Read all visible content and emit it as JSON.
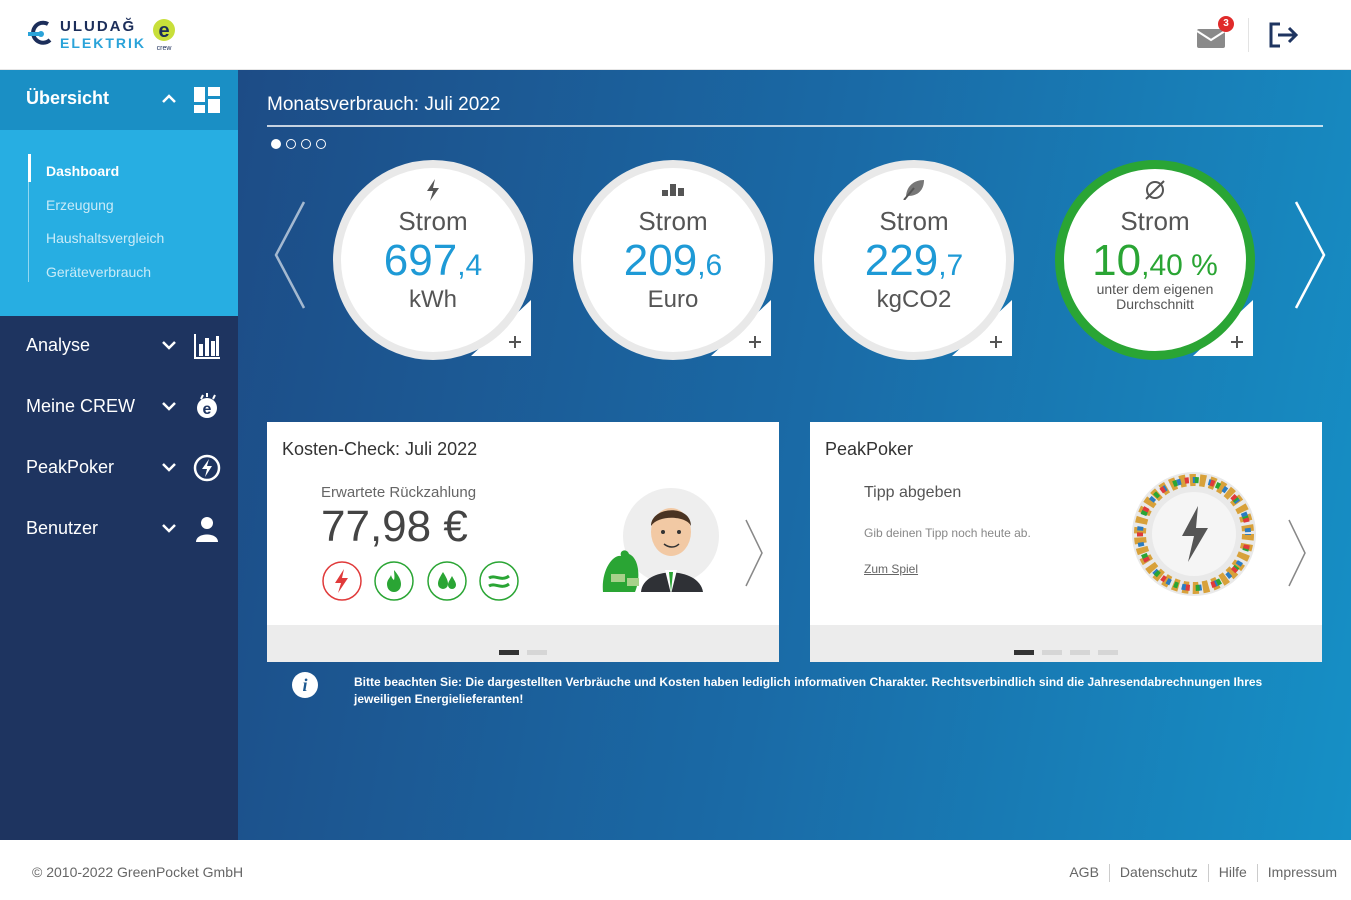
{
  "header": {
    "logo_line1": "ULUDAĞ",
    "logo_line2": "ELEKTRIK",
    "logo_crew": "crew",
    "mail_badge": "3"
  },
  "sidebar": {
    "open_section": "Übersicht",
    "sub_items": [
      "Dashboard",
      "Erzeugung",
      "Haushaltsvergleich",
      "Geräteverbrauch"
    ],
    "sections": [
      "Analyse",
      "Meine CREW",
      "PeakPoker",
      "Benutzer"
    ]
  },
  "main": {
    "month_title": "Monatsverbrauch: Juli 2022",
    "gauges": [
      {
        "label": "Strom",
        "value_int": "697",
        "value_dec": ",4",
        "unit": "kWh",
        "icon": "lightning-icon"
      },
      {
        "label": "Strom",
        "value_int": "209",
        "value_dec": ",6",
        "unit": "Euro",
        "icon": "coins-icon"
      },
      {
        "label": "Strom",
        "value_int": "229",
        "value_dec": ",7",
        "unit": "kgCO2",
        "icon": "leaf-icon"
      },
      {
        "label": "Strom",
        "value_int": "10",
        "value_dec": ",40 %",
        "unit": "unter dem eigenen Durchschnitt",
        "icon": "average-icon"
      }
    ],
    "cost_card": {
      "title": "Kosten-Check: Juli 2022",
      "subtitle": "Erwartete Rückzahlung",
      "value": "77,98 €"
    },
    "peak_card": {
      "title": "PeakPoker",
      "subtitle": "Tipp abgeben",
      "hint": "Gib deinen Tipp noch heute ab.",
      "link": "Zum Spiel"
    },
    "info_icon": "i",
    "notice": "Bitte beachten Sie: Die dargestellten Verbräuche und Kosten haben lediglich informativen Charakter. Rechtsverbindlich sind die Jahresendabrechnungen Ihres jeweiligen Energielieferanten!"
  },
  "footer": {
    "copyright": "© 2010-2022 GreenPocket GmbH",
    "links": [
      "AGB",
      "Datenschutz",
      "Hilfe",
      "Impressum"
    ]
  },
  "colors": {
    "sidebar": "#1e3460",
    "accent": "#1a8fc5",
    "value_blue": "#1e9ad6",
    "green": "#2aa534"
  }
}
